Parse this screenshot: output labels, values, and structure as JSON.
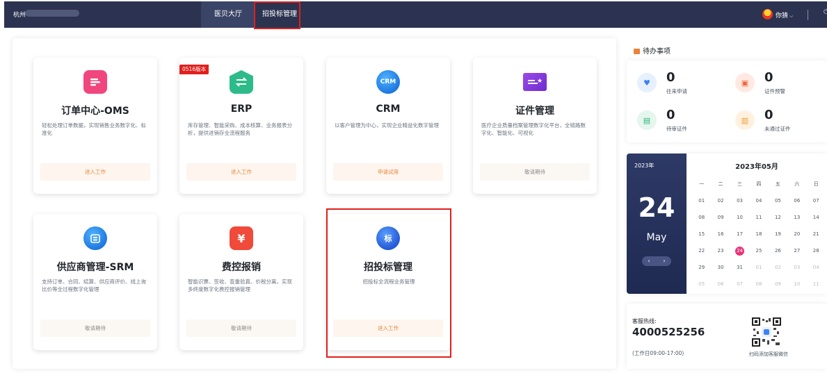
{
  "topbar": {
    "city": "杭州",
    "nav": [
      {
        "label": "医贝大厅",
        "active": true
      },
      {
        "label": "招投标管理",
        "active": false
      }
    ],
    "user": "你猜",
    "user_caret": "⌵",
    "power_icon": "power-icon"
  },
  "cards": [
    {
      "title": "订单中心-OMS",
      "desc": "轻松处理订单数据，实现销售业务数字化、标准化",
      "button": "进入工作",
      "icon": "oms-icon",
      "icon_color": "#f0467d",
      "icon_glyph": "☰"
    },
    {
      "title": "ERP",
      "desc": "库存管理、智能采购、成本核算、业务报表分析，提供进销存全流程服务",
      "button": "进入工作",
      "icon": "erp-icon",
      "icon_color": "#2dbb8a",
      "icon_glyph": "⇄",
      "badge": "0516版本"
    },
    {
      "title": "CRM",
      "desc": "以客户管理为中心，实现企业精益化数字管理",
      "button": "申请试用",
      "icon": "crm-icon",
      "icon_color": "#1e88e5",
      "icon_glyph": "CRM"
    },
    {
      "title": "证件管理",
      "desc": "医疗企业质量档案管理数字化平台，全链路数字化、智能化、可视化",
      "button": "敬请期待",
      "icon": "certificate-icon",
      "icon_color": "#8b3fd9",
      "icon_glyph": "★"
    },
    {
      "title": "供应商管理-SRM",
      "desc": "支持订单、合同、结算、供应商评价、线上询比价等全过程数字化管理",
      "button": "敬请期待",
      "icon": "supplier-icon",
      "icon_color": "#1e88e5",
      "icon_glyph": "▦"
    },
    {
      "title": "费控报销",
      "desc": "智能识票、签收、查重验真、价税分离，实现多终度数字化费控报销管理",
      "button": "敬请期待",
      "icon": "expense-icon",
      "icon_color": "#f04a3a",
      "icon_glyph": "¥"
    },
    {
      "title": "招投标管理",
      "desc": "招投标全流程业务管理",
      "button": "进入工作",
      "icon": "bidding-icon",
      "icon_color": "#2f6fe4",
      "icon_glyph": "标"
    }
  ],
  "todo": {
    "title": "待办事项",
    "items": [
      {
        "num": "0",
        "label": "往来申请",
        "icon": "exchange-request-icon",
        "color": "#e6f0ff",
        "glyph": "◉",
        "glyph_color": "#3b82f6"
      },
      {
        "num": "0",
        "label": "证件预警",
        "icon": "certificate-warning-icon",
        "color": "#ffe9e2",
        "glyph": "▣",
        "glyph_color": "#f0643c"
      },
      {
        "num": "0",
        "label": "待审证件",
        "icon": "pending-certificate-icon",
        "color": "#e4f6ee",
        "glyph": "▤",
        "glyph_color": "#2db37a"
      },
      {
        "num": "0",
        "label": "未通过证件",
        "icon": "rejected-certificate-icon",
        "color": "#fff1e0",
        "glyph": "▥",
        "glyph_color": "#f09a2c"
      }
    ]
  },
  "calendar": {
    "year": "2023年",
    "day": "24",
    "month": "May",
    "title": "2023年05月",
    "weekdays": [
      "一",
      "二",
      "三",
      "四",
      "五",
      "六",
      "日"
    ],
    "weeks": [
      [
        "01",
        "02",
        "03",
        "04",
        "05",
        "06",
        "07"
      ],
      [
        "08",
        "09",
        "10",
        "11",
        "12",
        "13",
        "14"
      ],
      [
        "15",
        "16",
        "17",
        "18",
        "19",
        "20",
        "21"
      ],
      [
        "22",
        "23",
        "24",
        "25",
        "26",
        "27",
        "28"
      ],
      [
        "29",
        "30",
        "31",
        "01",
        "02",
        "03",
        "04"
      ],
      [
        "05",
        "06",
        "07",
        "08",
        "09",
        "10",
        "11"
      ]
    ],
    "prev": "‹",
    "next": "›"
  },
  "hotline": {
    "label": "客服热线:",
    "number": "4000525256",
    "hours": "(工作日09:00-17:00)",
    "qr_caption": "扫码添加客服微信"
  }
}
